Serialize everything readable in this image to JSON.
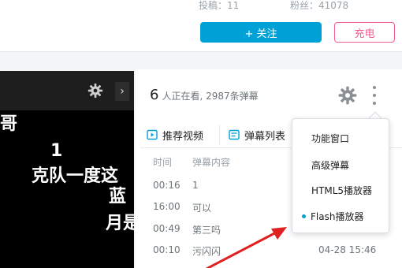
{
  "header": {
    "posts_label": "投稿：11",
    "fans_label": "粉丝：41078",
    "follow_label": "+ 关注",
    "charge_label": "充电"
  },
  "video": {
    "arrow_label": "›",
    "danmaku": [
      "哥",
      "1",
      "克队一度这",
      "蓝",
      "月是"
    ]
  },
  "panel": {
    "viewer_count": "6",
    "viewer_text": "人正在看, 2987条弹幕",
    "tabs": [
      {
        "label": "推荐视频"
      },
      {
        "label": "弹幕列表"
      }
    ],
    "columns": {
      "time": "时间",
      "content": "弹幕内容"
    },
    "rows": [
      {
        "time": "00:16",
        "content": "1",
        "date": ""
      },
      {
        "time": "16:00",
        "content": "可以",
        "date": ""
      },
      {
        "time": "00:49",
        "content": "第三吗",
        "date": ""
      },
      {
        "time": "00:10",
        "content": "污闪闪",
        "date": "04-28 15:46"
      }
    ]
  },
  "dropdown": {
    "items": [
      "功能窗口",
      "高级弹幕",
      "HTML5播放器",
      "Flash播放器"
    ],
    "selected": "Flash播放器"
  },
  "colors": {
    "accent": "#00a1d6",
    "charge": "#f25d8e",
    "annotation": "#e02020"
  }
}
